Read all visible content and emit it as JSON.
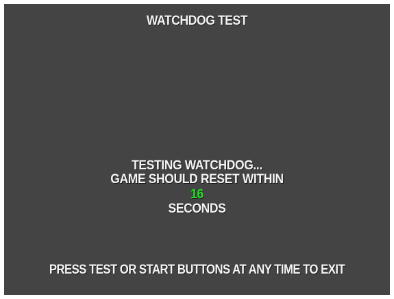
{
  "screen": {
    "title": "WATCHDOG TEST",
    "line1": "TESTING WATCHDOG...",
    "line2": "GAME SHOULD RESET WITHIN",
    "countdown": "16",
    "countdown_color": "#22e022",
    "line4": "SECONDS",
    "footer": "PRESS TEST OR START BUTTONS AT ANY TIME TO EXIT",
    "background_color": "#444444",
    "text_color": "#f4f4f4"
  }
}
